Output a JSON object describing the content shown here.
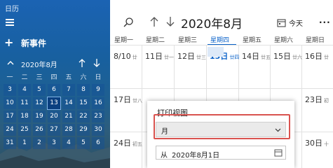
{
  "app": {
    "title": "日历"
  },
  "sidebar": {
    "new_event_label": "新事件",
    "mini_calendar": {
      "month_label": "2020年8月",
      "weekdays": [
        "一",
        "二",
        "三",
        "四",
        "五",
        "六",
        "日"
      ],
      "weeks": [
        [
          "3",
          "4",
          "5",
          "6",
          "7",
          "8",
          "9"
        ],
        [
          "10",
          "11",
          "12",
          "13",
          "14",
          "15",
          "16"
        ],
        [
          "17",
          "18",
          "19",
          "20",
          "21",
          "22",
          "23"
        ],
        [
          "24",
          "25",
          "26",
          "27",
          "28",
          "29",
          "30"
        ],
        [
          "31",
          "1",
          "2",
          "3",
          "4",
          "5",
          "6"
        ]
      ],
      "selected_day": "13"
    }
  },
  "toolbar": {
    "month_title": "2020年8月",
    "today_label": "今天",
    "more_label": "···"
  },
  "calendar": {
    "weekdays": [
      "星期一",
      "星期二",
      "星期三",
      "星期四",
      "星期五",
      "星期六",
      "星期日"
    ],
    "selected_weekday_index": 3,
    "rows": [
      [
        {
          "num": "8/10",
          "lunar": "廿"
        },
        {
          "num": "11日",
          "lunar": "廿一"
        },
        {
          "num": "12日",
          "lunar": "廿三"
        },
        {
          "num": "13日",
          "lunar": "廿四"
        },
        {
          "num": "14日",
          "lunar": "廿五"
        },
        {
          "num": "15日",
          "lunar": "廿六"
        },
        {
          "num": "16日",
          "lunar": "廿"
        }
      ],
      [
        {
          "num": "17日",
          "lunar": "廿八"
        },
        {
          "num": "",
          "lunar": ""
        },
        {
          "num": "",
          "lunar": ""
        },
        {
          "num": "",
          "lunar": ""
        },
        {
          "num": "",
          "lunar": ""
        },
        {
          "num": "",
          "lunar": ""
        },
        {
          "num": "23日",
          "lunar": "初"
        }
      ],
      [
        {
          "num": "24日",
          "lunar": "初五"
        },
        {
          "num": "",
          "lunar": ""
        },
        {
          "num": "",
          "lunar": ""
        },
        {
          "num": "",
          "lunar": ""
        },
        {
          "num": "",
          "lunar": ""
        },
        {
          "num": "",
          "lunar": ""
        },
        {
          "num": "30日",
          "lunar": "十"
        }
      ]
    ]
  },
  "print_dialog": {
    "title": "打印视图",
    "view_value": "月",
    "from_label": "从",
    "from_value": "2020年8月1日"
  },
  "colors": {
    "accent": "#0a62c9",
    "highlight": "#d9534f"
  }
}
